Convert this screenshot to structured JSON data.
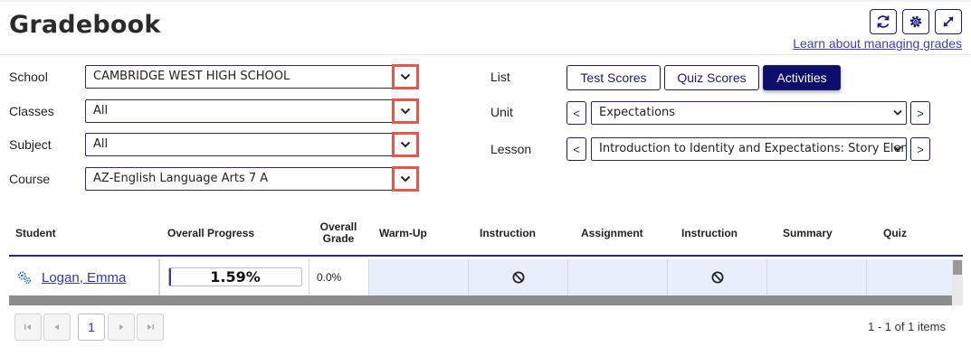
{
  "page": {
    "title": "Gradebook",
    "learn_link": "Learn about managing grades"
  },
  "toolbar": {
    "icons": [
      "refresh-icon",
      "gear-icon",
      "expand-icon"
    ]
  },
  "filters": {
    "school": {
      "label": "School",
      "value": "CAMBRIDGE WEST HIGH SCHOOL"
    },
    "classes": {
      "label": "Classes",
      "value": "All"
    },
    "subject": {
      "label": "Subject",
      "value": "All"
    },
    "course": {
      "label": "Course",
      "value": "AZ-English Language Arts 7 A"
    }
  },
  "list": {
    "label": "List",
    "options": [
      "Test Scores",
      "Quiz Scores",
      "Activities"
    ],
    "selected": "Activities"
  },
  "unit": {
    "label": "Unit",
    "value": "Expectations",
    "prev": "<",
    "next": ">"
  },
  "lesson": {
    "label": "Lesson",
    "value": "Introduction to Identity and Expectations: Story Elements",
    "prev": "<",
    "next": ">"
  },
  "grid": {
    "columns": [
      "Student",
      "Overall Progress",
      "Overall Grade",
      "Warm-Up",
      "Instruction",
      "Assignment",
      "Instruction",
      "Summary",
      "Quiz"
    ],
    "rows": [
      {
        "student": "Logan, Emma",
        "progress_text": "1.59%",
        "progress_value": 1.59,
        "grade": "0.0%",
        "cells": [
          "",
          "blocked",
          "",
          "blocked",
          "",
          ""
        ]
      }
    ]
  },
  "pager": {
    "current_page": "1",
    "info": "1 - 1 of 1 items"
  },
  "colors": {
    "accent": "#1b1b73",
    "active_tab": "#0d0d6b",
    "highlight": "#e8564a",
    "row_bg": "#e8eefa"
  }
}
